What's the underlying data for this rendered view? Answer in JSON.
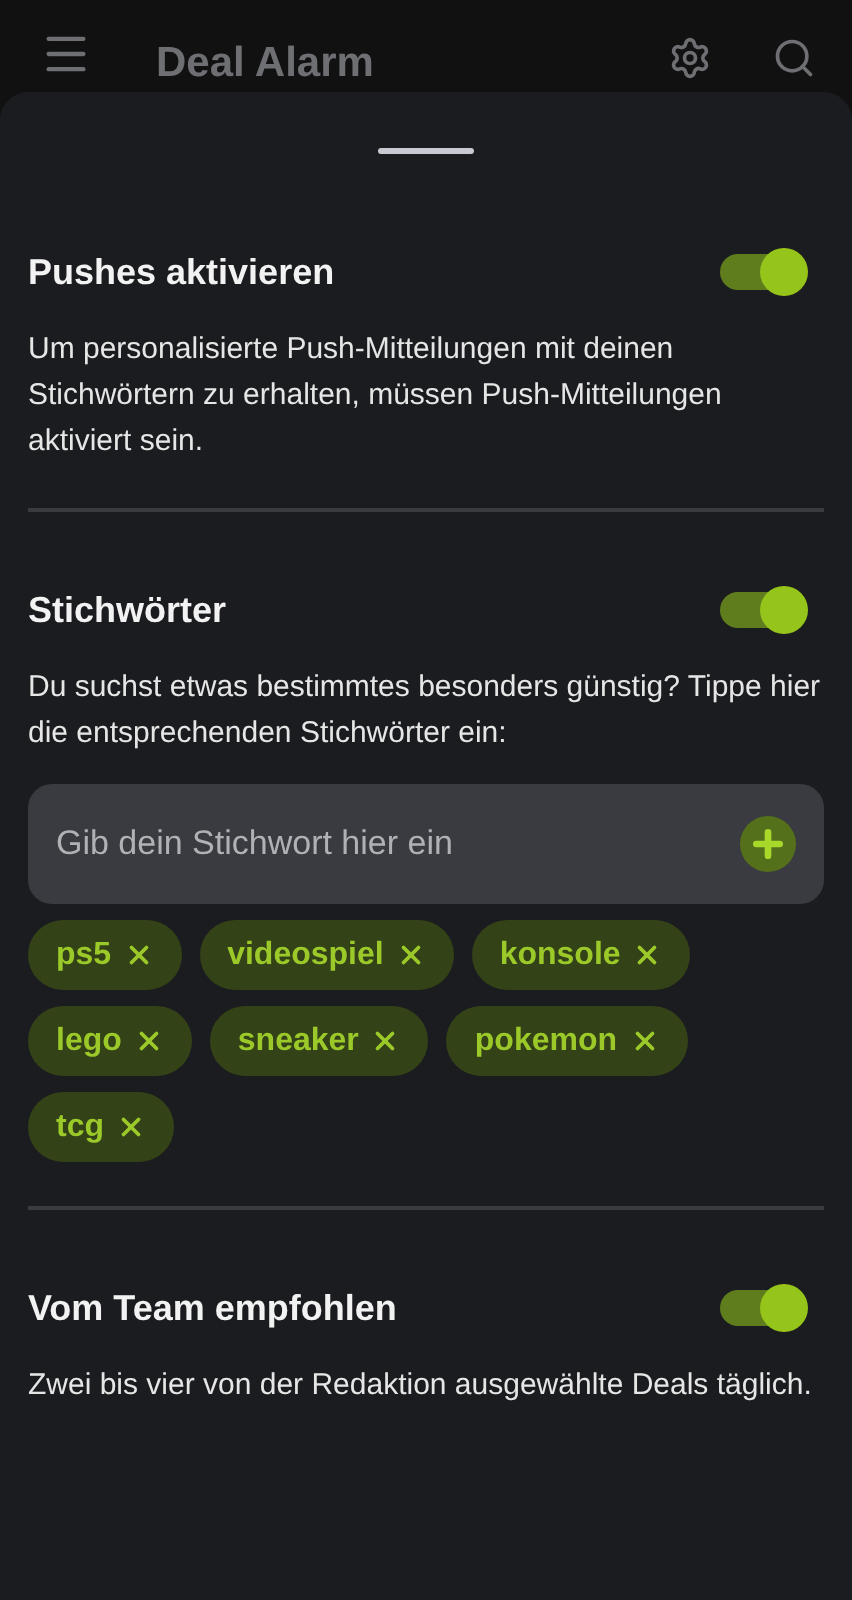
{
  "app_bar": {
    "title": "Deal Alarm"
  },
  "sections": [
    {
      "kind": "text",
      "title": "Pushes aktivieren",
      "on": true,
      "description": "Um personalisierte Push-Mitteilungen mit deinen Stichwörtern zu erhalten, müssen Push-Mitteilungen aktiviert sein."
    },
    {
      "kind": "keywords",
      "title": "Stichwörter",
      "on": true,
      "description": "Du suchst etwas bestimmtes besonders günstig? Tippe hier die entsprechenden Stichwörter ein:",
      "input": {
        "placeholder": "Gib dein Stichwort hier ein"
      },
      "keywords": [
        "ps5",
        "videospiel",
        "konsole",
        "lego",
        "sneaker",
        "pokemon",
        "tcg"
      ]
    },
    {
      "kind": "text",
      "title": "Vom Team empfohlen",
      "on": true,
      "description": "Zwei bis vier von der Redaktion ausgewählte Deals täglich."
    }
  ]
}
